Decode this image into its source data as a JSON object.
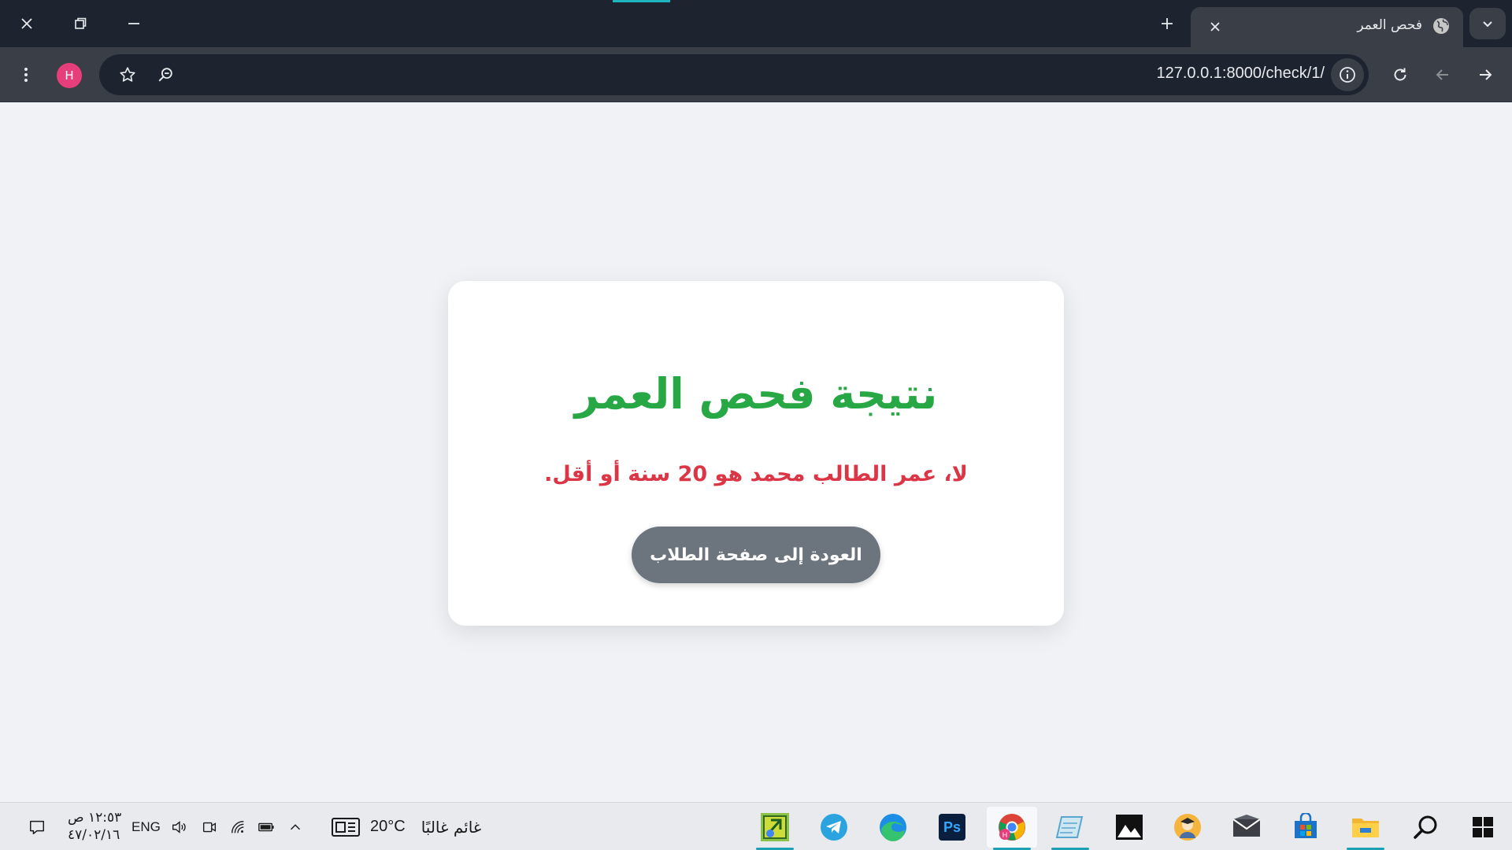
{
  "browser": {
    "tab": {
      "title": "فحص العمر",
      "icon": "globe-icon"
    },
    "address": {
      "url": "127.0.0.1:8000/check/1/"
    },
    "profile": {
      "initial": "H",
      "color": "#e63e7a"
    }
  },
  "page": {
    "title": "نتيجة فحص العمر",
    "message": "لا، عمر الطالب محمد هو 20 سنة أو أقل.",
    "back_button": "العودة إلى صفحة الطلاب",
    "colors": {
      "title": "#28a745",
      "message": "#dc3545",
      "button": "#6c757d"
    }
  },
  "taskbar": {
    "time": "١٢:٥٣ ص",
    "date": "٤٧/٠٢/١٦",
    "language": "ENG",
    "weather": {
      "temp": "20°C",
      "condition": "غائم غالبًا"
    },
    "apps": [
      {
        "name": "windows-start-icon"
      },
      {
        "name": "search-icon"
      },
      {
        "name": "file-explorer-icon"
      },
      {
        "name": "microsoft-store-icon"
      },
      {
        "name": "mail-icon"
      },
      {
        "name": "avatar-app-icon"
      },
      {
        "name": "photos-icon"
      },
      {
        "name": "notepad-icon"
      },
      {
        "name": "chrome-icon"
      },
      {
        "name": "photoshop-icon",
        "label": "Ps"
      },
      {
        "name": "edge-icon"
      },
      {
        "name": "telegram-icon"
      },
      {
        "name": "tool-app-icon"
      }
    ]
  }
}
